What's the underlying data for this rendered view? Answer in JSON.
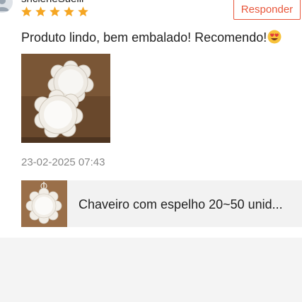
{
  "review": {
    "username": "sncleneSuelli",
    "rating": 5,
    "reply_label": "Responder",
    "text": "Produto lindo, bem embalado! Recomendo!",
    "emoji_icon": "heart-eyes-emoji",
    "date": "23-02-2025 07:43"
  },
  "product": {
    "title": "Chaveiro com espelho 20~50 unid..."
  },
  "colors": {
    "accent": "#e8563b",
    "star": "#f5a623",
    "muted_text": "#888888",
    "product_bg": "#f2f2f2",
    "page_bg": "#f4f4f4"
  }
}
